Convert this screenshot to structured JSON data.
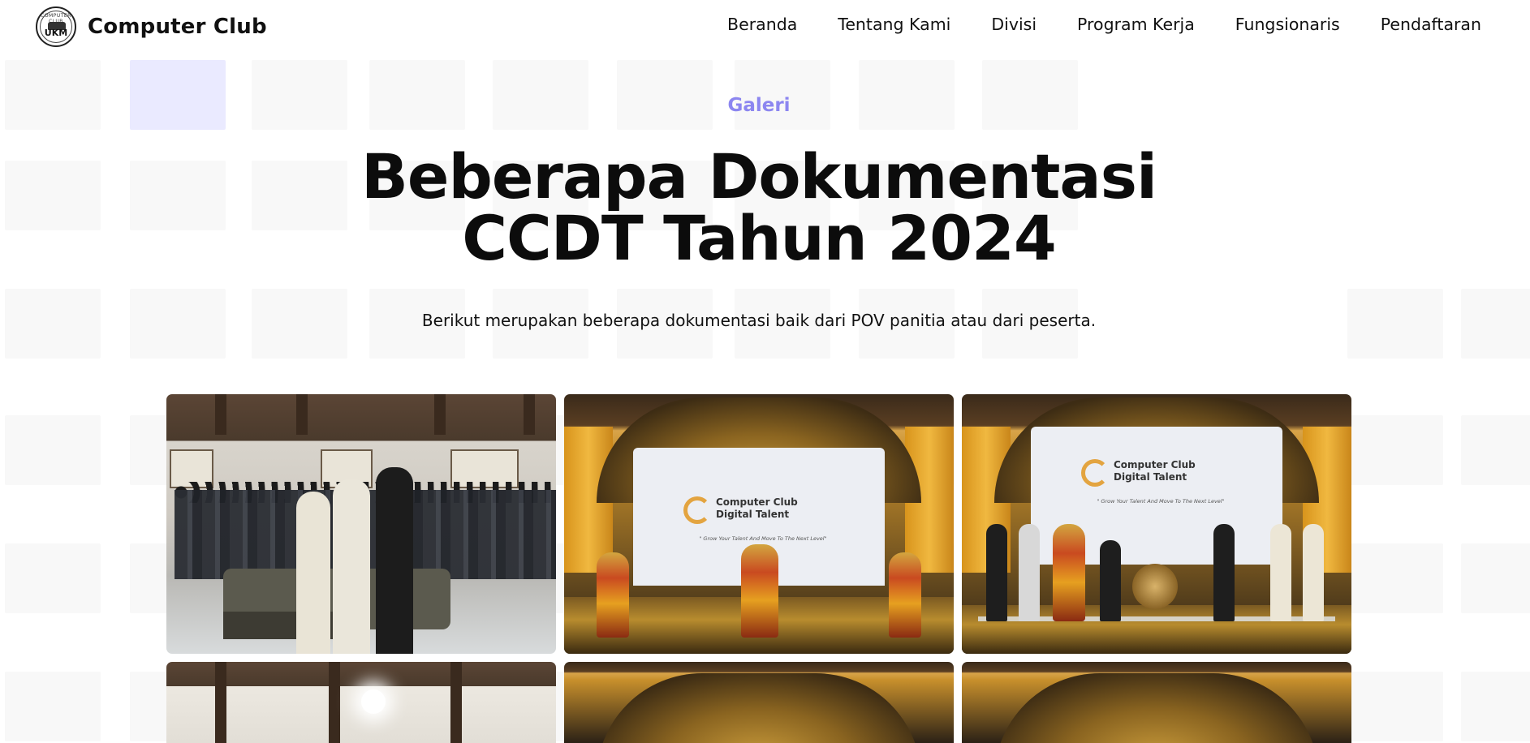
{
  "brand": {
    "name": "Computer Club",
    "logo_text": "UKM",
    "logo_top": "COMPUTER CLUB"
  },
  "nav": [
    {
      "label": "Beranda"
    },
    {
      "label": "Tentang Kami"
    },
    {
      "label": "Divisi"
    },
    {
      "label": "Program Kerja"
    },
    {
      "label": "Fungsionaris"
    },
    {
      "label": "Pendaftaran"
    }
  ],
  "hero": {
    "eyebrow": "Galeri",
    "title_line1": "Beberapa Dokumentasi",
    "title_line2": "CCDT Tahun 2024",
    "subtitle": "Berikut merupakan beberapa dokumentasi baik dari POV panitia atau dari peserta."
  },
  "banner": {
    "line1": "Computer Club",
    "line2": "Digital Talent",
    "tagline": "\" Grow Your Talent And Move To The Next Level\""
  },
  "colors": {
    "accent": "#8c86f0",
    "text": "#111111",
    "background": "#ffffff"
  }
}
